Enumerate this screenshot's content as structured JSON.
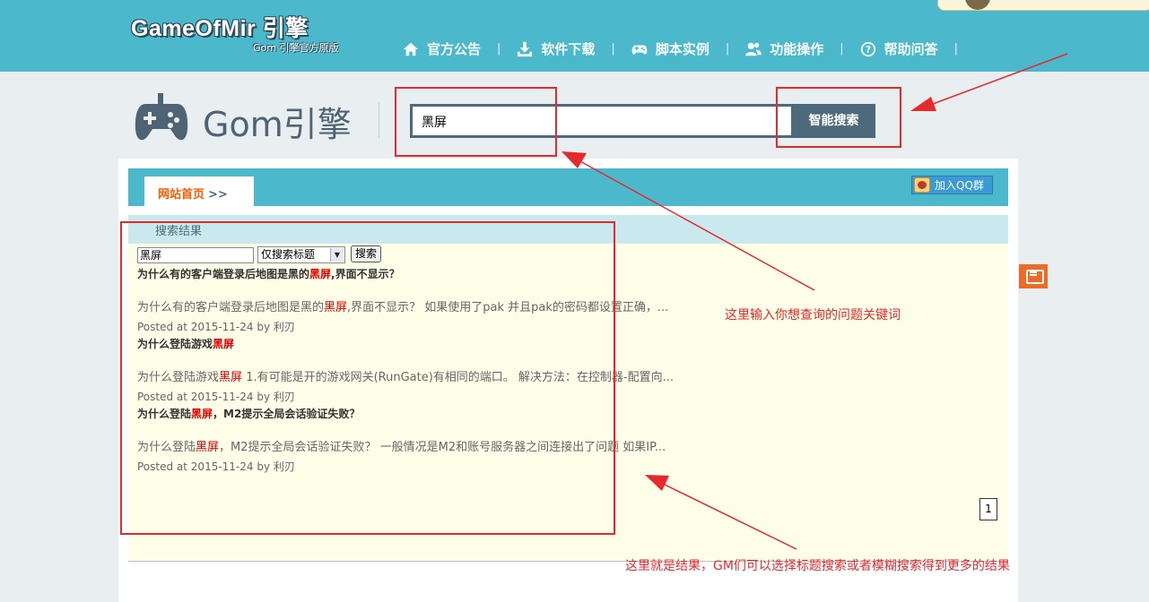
{
  "header": {
    "logo_text": "GameOfMir 引擎",
    "logo_sub": "Gom 引擎官方原版",
    "nav": [
      {
        "label": "官方公告",
        "icon": "home-icon"
      },
      {
        "label": "软件下载",
        "icon": "download-icon"
      },
      {
        "label": "脚本实例",
        "icon": "gamepad-icon"
      },
      {
        "label": "功能操作",
        "icon": "users-icon"
      },
      {
        "label": "帮助问答",
        "icon": "help-icon"
      }
    ],
    "separator": "|"
  },
  "search": {
    "brand": "Gom引擎",
    "query": "黑屏",
    "button_label": "智能搜索"
  },
  "breadcrumb": {
    "home_label": "网站首页",
    "arrow": ">>",
    "qq_label": "加入QQ群"
  },
  "results": {
    "header": "搜索结果",
    "mini_query": "黑屏",
    "scope_option": "仅搜索标题",
    "mini_button": "搜索",
    "items": [
      {
        "title_pre": "为什么有的客户端登录后地图是黑的",
        "title_hl": "黑屏",
        "title_post": ",界面不显示？",
        "snip_pre": "为什么有的客户端登录后地图是黑的",
        "snip_hl": "黑屏",
        "snip_post": ",界面不显示？ 如果使用了pak 并且pak的密码都设置正确，...",
        "meta": "Posted at 2015-11-24 by 利刃"
      },
      {
        "title_pre": "为什么登陆游戏",
        "title_hl": "黑屏",
        "title_post": "",
        "snip_pre": "为什么登陆游戏",
        "snip_hl": "黑屏",
        "snip_post": " 1.有可能是开的游戏网关(RunGate)有相同的端口。 解决方法：在控制器-配置向...",
        "meta": "Posted at 2015-11-24 by 利刃"
      },
      {
        "title_pre": "为什么登陆",
        "title_hl": "黑屏",
        "title_post": "，M2提示全局会话验证失败？",
        "snip_pre": "为什么登陆",
        "snip_hl": "黑屏",
        "snip_post": "，M2提示全局会话验证失败？ 一般情况是M2和账号服务器之间连接出了问题 如果IP...",
        "meta": "Posted at 2015-11-24 by 利刃"
      }
    ],
    "page": "1"
  },
  "annotations": {
    "keyword_note": "这里输入你想查询的问题关键词",
    "result_note": "这里就是结果，GM们可以选择标题搜索或者模糊搜索得到更多的结果",
    "color": "#e8292c"
  }
}
